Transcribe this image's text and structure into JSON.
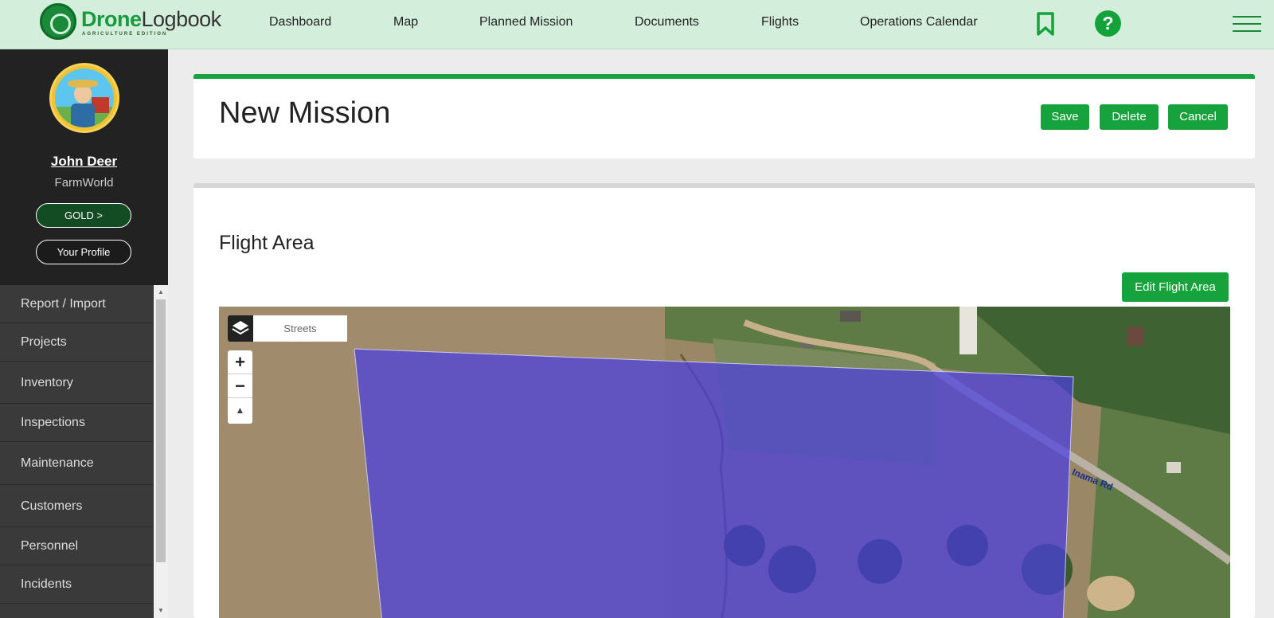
{
  "app": {
    "logo_primary": "Drone",
    "logo_secondary": "Logbook",
    "logo_sub": "AGRICULTURE EDITION"
  },
  "nav": {
    "items": [
      "Dashboard",
      "Map",
      "Planned Mission",
      "Documents",
      "Flights",
      "Operations Calendar"
    ],
    "help_glyph": "?"
  },
  "user": {
    "name": "John Deer",
    "company": "FarmWorld",
    "plan_button": "GOLD >",
    "profile_button": "Your Profile"
  },
  "sidebar": {
    "items": [
      "Report / Import",
      "Projects",
      "Inventory",
      "Inspections",
      "Maintenance",
      "Customers",
      "Personnel",
      "Incidents"
    ]
  },
  "page": {
    "title": "New Mission",
    "save_label": "Save",
    "delete_label": "Delete",
    "cancel_label": "Cancel"
  },
  "flight_area": {
    "title": "Flight Area",
    "edit_button": "Edit Flight Area",
    "map_layer": "Streets",
    "zoom_in": "+",
    "zoom_out": "−",
    "compass": "▲",
    "road_label": "Inama Rd"
  },
  "colors": {
    "accent": "#16a23c",
    "nav_bg": "#d4eedc",
    "sidebar_bg": "#222222",
    "polygon": "#5a4fe0"
  }
}
